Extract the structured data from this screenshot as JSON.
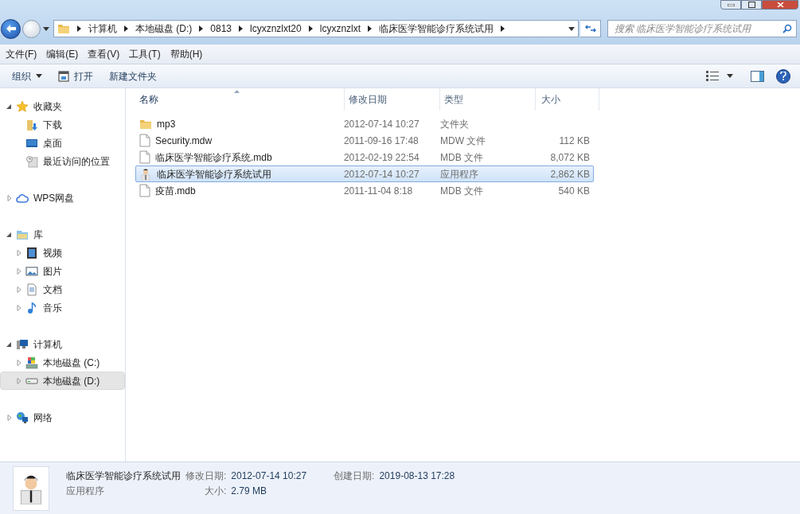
{
  "address": {
    "breadcrumbs": [
      "计算机",
      "本地磁盘 (D:)",
      "0813",
      "lcyxznzlxt20",
      "lcyxznzlxt",
      "临床医学智能诊疗系统试用"
    ]
  },
  "search": {
    "placeholder": "搜索 临床医学智能诊疗系统试用"
  },
  "menu": [
    "文件(F)",
    "编辑(E)",
    "查看(V)",
    "工具(T)",
    "帮助(H)"
  ],
  "toolbar": [
    {
      "label": "组织",
      "kind": "dropdown"
    },
    {
      "label": "打开",
      "kind": "open"
    },
    {
      "label": "新建文件夹",
      "kind": "plain"
    }
  ],
  "sidebar": [
    {
      "label": "收藏夹",
      "kind": "star",
      "expanded": true,
      "selected": false,
      "children": [
        {
          "label": "下载",
          "kind": "download",
          "selected": false
        },
        {
          "label": "桌面",
          "kind": "desktop",
          "selected": false
        },
        {
          "label": "最近访问的位置",
          "kind": "recent",
          "selected": false
        }
      ]
    },
    {
      "label": "WPS网盘",
      "kind": "cloud",
      "expanded": false,
      "selected": false
    },
    {
      "label": "库",
      "kind": "library",
      "expanded": true,
      "selected": false,
      "children": [
        {
          "label": "视频",
          "kind": "video",
          "expanded": false,
          "selected": false
        },
        {
          "label": "图片",
          "kind": "picture",
          "expanded": false,
          "selected": false
        },
        {
          "label": "文档",
          "kind": "document",
          "expanded": false,
          "selected": false
        },
        {
          "label": "音乐",
          "kind": "music",
          "expanded": false,
          "selected": false
        }
      ]
    },
    {
      "label": "计算机",
      "kind": "computer",
      "expanded": true,
      "selected": false,
      "children": [
        {
          "label": "本地磁盘 (C:)",
          "kind": "system",
          "expanded": false,
          "selected": false
        },
        {
          "label": "本地磁盘 (D:)",
          "kind": "drive",
          "expanded": false,
          "selected": true
        }
      ]
    },
    {
      "label": "网络",
      "kind": "network",
      "expanded": false,
      "selected": false
    }
  ],
  "columns": [
    {
      "label": "名称",
      "sorted": true
    },
    {
      "label": "修改日期",
      "sorted": false
    },
    {
      "label": "类型",
      "sorted": false
    },
    {
      "label": "大小",
      "sorted": false
    }
  ],
  "rows": [
    {
      "name": "mp3",
      "modified": "2012-07-14 10:27",
      "type": "文件夹",
      "size": "",
      "kind": "folder",
      "selected": false
    },
    {
      "name": "Security.mdw",
      "modified": "2011-09-16 17:48",
      "type": "MDW 文件",
      "size": "112 KB",
      "kind": "file",
      "selected": false
    },
    {
      "name": "临床医学智能诊疗系统.mdb",
      "modified": "2012-02-19 22:54",
      "type": "MDB 文件",
      "size": "8,072 KB",
      "kind": "file",
      "selected": false
    },
    {
      "name": "临床医学智能诊疗系统试用",
      "modified": "2012-07-14 10:27",
      "type": "应用程序",
      "size": "2,862 KB",
      "kind": "app",
      "selected": true
    },
    {
      "name": "疫苗.mdb",
      "modified": "2011-11-04 8:18",
      "type": "MDB 文件",
      "size": "540 KB",
      "kind": "file",
      "selected": false
    }
  ],
  "details": {
    "name": "临床医学智能诊疗系统试用",
    "type": "应用程序",
    "modified_label": "修改日期:",
    "modified": "2012-07-14 10:27",
    "created_label": "创建日期:",
    "created": "2019-08-13 17:28",
    "size_label": "大小:",
    "size": "2.79 MB"
  }
}
